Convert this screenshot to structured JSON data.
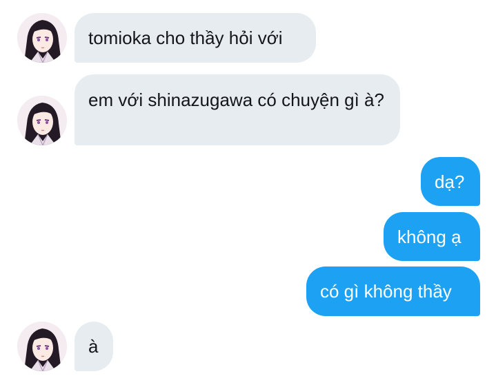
{
  "colors": {
    "incoming_bubble": "#e6ecf0",
    "outgoing_bubble": "#1da1f2",
    "incoming_text": "#14171a",
    "outgoing_text": "#ffffff"
  },
  "messages": [
    {
      "side": "incoming",
      "text": "tomioka cho thầy hỏi với",
      "avatar_icon": "avatar-icon"
    },
    {
      "side": "incoming",
      "text": "em với shinazugawa có chuyện gì à?",
      "avatar_icon": "avatar-icon"
    },
    {
      "side": "outgoing",
      "text": "dạ?"
    },
    {
      "side": "outgoing",
      "text": "không ạ"
    },
    {
      "side": "outgoing",
      "text": "có gì không thầy"
    },
    {
      "side": "incoming",
      "text": "à",
      "avatar_icon": "avatar-icon"
    }
  ]
}
